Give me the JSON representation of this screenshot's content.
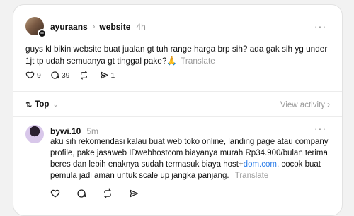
{
  "post": {
    "username": "ayuraans",
    "community": "website",
    "time": "4h",
    "text": "guys kl bikin website buat jualan gt tuh range harga brp sih? ada gak sih yg under 1jt tp udah semuanya gt tinggal pake?🙏",
    "translate_label": "Translate",
    "like_count": "9",
    "reply_count": "39",
    "repost_count": "",
    "share_count": "1"
  },
  "sort": {
    "label": "Top",
    "view_activity": "View activity"
  },
  "reply": {
    "username": "bywi.10",
    "time": "5m",
    "text_before_link": "aku sih rekomendasi kalau buat web toko online, landing page atau company profile, pake jasaweb IDwebhostcom biayanya murah Rp34.900/bulan terima beres dan lebih enaknya sudah termasuk biaya host+",
    "link_text": "dom.com",
    "text_after_link": ", cocok buat pemula jadi aman untuk scale up jangka panjang.",
    "translate_label": "Translate"
  },
  "icons": [
    "heart-icon",
    "comment-icon",
    "repost-icon",
    "share-icon",
    "more-icon",
    "sort-icon",
    "chevron-down-icon",
    "chevron-right-icon"
  ]
}
